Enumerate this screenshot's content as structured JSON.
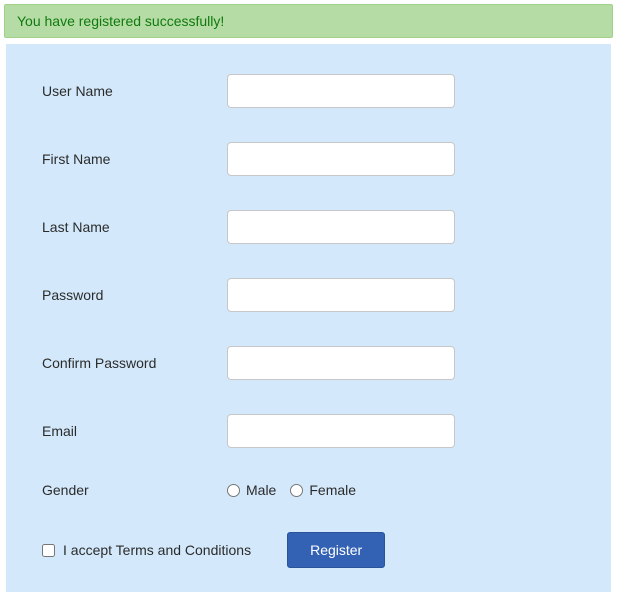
{
  "banner": {
    "message": "You have registered successfully!"
  },
  "form": {
    "fields": {
      "username": {
        "label": "User Name",
        "value": ""
      },
      "firstname": {
        "label": "First Name",
        "value": ""
      },
      "lastname": {
        "label": "Last Name",
        "value": ""
      },
      "password": {
        "label": "Password",
        "value": ""
      },
      "confirm_password": {
        "label": "Confirm Password",
        "value": ""
      },
      "email": {
        "label": "Email",
        "value": ""
      },
      "gender": {
        "label": "Gender",
        "options": {
          "male": "Male",
          "female": "Female"
        }
      }
    },
    "terms": {
      "label": "I accept Terms and Conditions",
      "checked": false
    },
    "submit": {
      "label": "Register"
    }
  }
}
